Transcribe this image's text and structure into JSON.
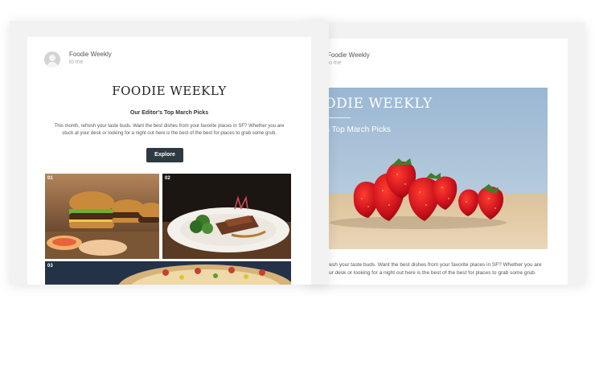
{
  "front_email": {
    "sender": "Foodie Weekly",
    "to": "to me",
    "brand": "FOODIE WEEKLY",
    "subhead": "Our Editor's Top March Picks",
    "intro": "This month, refresh your taste buds. Want the best dishes from your favorite places in SF? Whether you are stuck at your desk or looking for a night out here is the best of the best for places to grab some grub.",
    "button": "Explore",
    "tiles": [
      {
        "number": "01",
        "subject": "burgers"
      },
      {
        "number": "02",
        "subject": "plated steak with broccoli"
      },
      {
        "number": "03",
        "subject": "pizza"
      }
    ]
  },
  "back_email": {
    "sender": "Foodie Weekly",
    "to": "to me",
    "hero_title": "FOODIE WEEKLY",
    "hero_subtitle": "Editor's Top March Picks",
    "hero_subject": "strawberries",
    "intro_line1": "month, refresh your taste buds. Want the best dishes from your favorite places in SF? Whether you are",
    "intro_line2": "stuck at your desk or looking for a night out here is the best of the best for places to grab some grub."
  }
}
